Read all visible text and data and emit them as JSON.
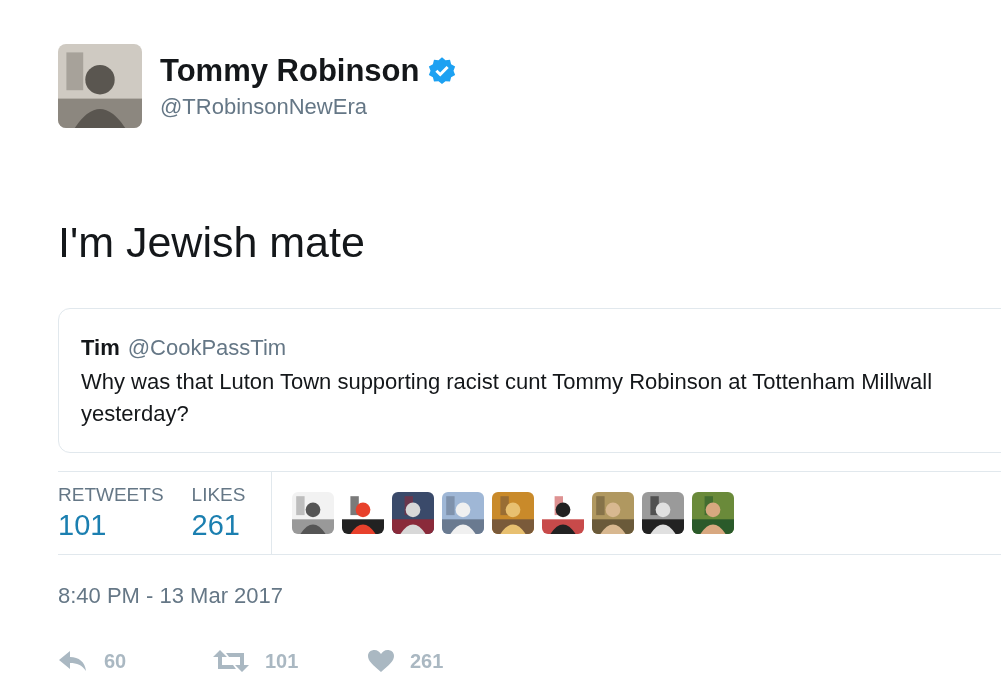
{
  "author": {
    "name": "Tommy Robinson",
    "verified": true,
    "handle": "@TRobinsonNewEra"
  },
  "text": "I'm Jewish mate",
  "quoted": {
    "name": "Tim",
    "handle": "@CookPassTim",
    "text": "Why was that Luton Town supporting racist cunt Tommy Robinson at Tottenham Millwall yesterday?"
  },
  "stats": [
    {
      "label": "RETWEETS",
      "value": "101"
    },
    {
      "label": "LIKES",
      "value": "261"
    }
  ],
  "timestamp": "8:40 PM - 13 Mar 2017",
  "actions": [
    {
      "kind": "reply",
      "count": "60"
    },
    {
      "kind": "retweet",
      "count": "101"
    },
    {
      "kind": "like",
      "count": "261"
    }
  ]
}
